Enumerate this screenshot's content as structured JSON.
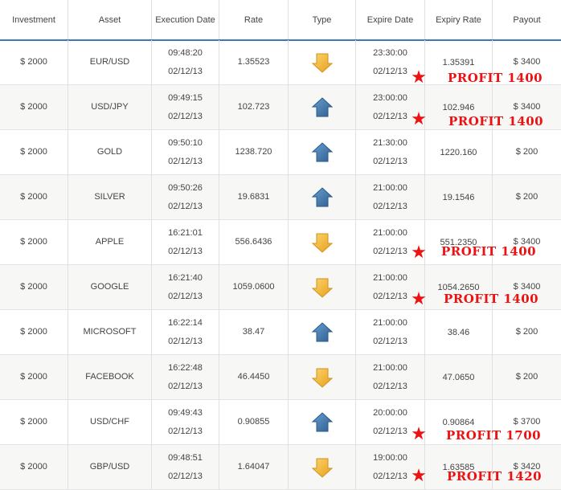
{
  "columns": [
    "Investment",
    "Asset",
    "Execution Date",
    "Rate",
    "Type",
    "Expire Date",
    "Expiry Rate",
    "Payout"
  ],
  "colors": {
    "accent": "#3d78b8",
    "up": "#3f79b0",
    "down": "#f2b53a",
    "profit": "#ee1111"
  },
  "rows": [
    {
      "investment": "$ 2000",
      "asset": "EUR/USD",
      "exec_time": "09:48:20",
      "exec_date": "02/12/13",
      "rate": "1.35523",
      "type": "down",
      "expire_time": "23:30:00",
      "expire_date": "02/12/13",
      "expiry_rate": "1.35391",
      "payout": "$ 3400",
      "profit": "PROFIT 1400"
    },
    {
      "investment": "$ 2000",
      "asset": "USD/JPY",
      "exec_time": "09:49:15",
      "exec_date": "02/12/13",
      "rate": "102.723",
      "type": "up",
      "expire_time": "23:00:00",
      "expire_date": "02/12/13",
      "expiry_rate": "102.946",
      "payout": "$ 3400",
      "profit": "PROFIT 1400"
    },
    {
      "investment": "$ 2000",
      "asset": "GOLD",
      "exec_time": "09:50:10",
      "exec_date": "02/12/13",
      "rate": "1238.720",
      "type": "up",
      "expire_time": "21:30:00",
      "expire_date": "02/12/13",
      "expiry_rate": "1220.160",
      "payout": "$ 200",
      "profit": ""
    },
    {
      "investment": "$ 2000",
      "asset": "SILVER",
      "exec_time": "09:50:26",
      "exec_date": "02/12/13",
      "rate": "19.6831",
      "type": "up",
      "expire_time": "21:00:00",
      "expire_date": "02/12/13",
      "expiry_rate": "19.1546",
      "payout": "$ 200",
      "profit": ""
    },
    {
      "investment": "$ 2000",
      "asset": "APPLE",
      "exec_time": "16:21:01",
      "exec_date": "02/12/13",
      "rate": "556.6436",
      "type": "down",
      "expire_time": "21:00:00",
      "expire_date": "02/12/13",
      "expiry_rate": "551.2350",
      "payout": "$ 3400",
      "profit": "PROFIT 1400"
    },
    {
      "investment": "$ 2000",
      "asset": "GOOGLE",
      "exec_time": "16:21:40",
      "exec_date": "02/12/13",
      "rate": "1059.0600",
      "type": "down",
      "expire_time": "21:00:00",
      "expire_date": "02/12/13",
      "expiry_rate": "1054.2650",
      "payout": "$ 3400",
      "profit": "PROFIT 1400"
    },
    {
      "investment": "$ 2000",
      "asset": "MICROSOFT",
      "exec_time": "16:22:14",
      "exec_date": "02/12/13",
      "rate": "38.47",
      "type": "up",
      "expire_time": "21:00:00",
      "expire_date": "02/12/13",
      "expiry_rate": "38.46",
      "payout": "$ 200",
      "profit": ""
    },
    {
      "investment": "$ 2000",
      "asset": "FACEBOOK",
      "exec_time": "16:22:48",
      "exec_date": "02/12/13",
      "rate": "46.4450",
      "type": "down",
      "expire_time": "21:00:00",
      "expire_date": "02/12/13",
      "expiry_rate": "47.0650",
      "payout": "$ 200",
      "profit": ""
    },
    {
      "investment": "$ 2000",
      "asset": "USD/CHF",
      "exec_time": "09:49:43",
      "exec_date": "02/12/13",
      "rate": "0.90855",
      "type": "up",
      "expire_time": "20:00:00",
      "expire_date": "02/12/13",
      "expiry_rate": "0.90864",
      "payout": "$ 3700",
      "profit": "PROFIT 1700"
    },
    {
      "investment": "$ 2000",
      "asset": "GBP/USD",
      "exec_time": "09:48:51",
      "exec_date": "02/12/13",
      "rate": "1.64047",
      "type": "down",
      "expire_time": "19:00:00",
      "expire_date": "02/12/13",
      "expiry_rate": "1.63585",
      "payout": "$ 3420",
      "profit": "PROFIT 1420"
    }
  ]
}
